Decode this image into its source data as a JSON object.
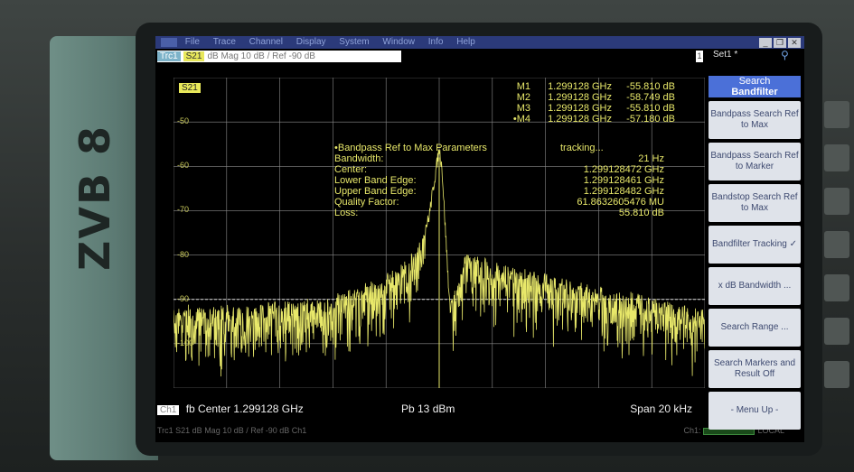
{
  "device": {
    "brand": "ZVB 8"
  },
  "menubar": {
    "items": [
      "File",
      "Trace",
      "Channel",
      "Display",
      "System",
      "Window",
      "Info",
      "Help"
    ]
  },
  "set_label": "Set1 *",
  "trace_header": {
    "trc": "Trc1",
    "param": "S21",
    "rest": "dB Mag  10 dB /  Ref -90 dB"
  },
  "page_num": "1",
  "trace_chip": "S21",
  "y_tick_labels": [
    "-50",
    "-60",
    "-70",
    "-80",
    "-90",
    "-100"
  ],
  "markers": [
    {
      "id": "M1",
      "freq": "1.299128 GHz",
      "value": "-55.810 dB"
    },
    {
      "id": "M2",
      "freq": "1.299128 GHz",
      "value": "-58.749 dB"
    },
    {
      "id": "M3",
      "freq": "1.299128 GHz",
      "value": "-55.810 dB"
    },
    {
      "id": "•M4",
      "freq": "1.299128 GHz",
      "value": "-57.180 dB"
    }
  ],
  "params": {
    "title": "•Bandpass Ref to Max Parameters",
    "status": "tracking...",
    "rows": [
      {
        "label": "Bandwidth:",
        "value": "21 Hz"
      },
      {
        "label": "Center:",
        "value": "1.299128472 GHz"
      },
      {
        "label": "Lower Band Edge:",
        "value": "1.299128461 GHz"
      },
      {
        "label": "Upper Band Edge:",
        "value": "1.299128482 GHz"
      },
      {
        "label": "Quality Factor:",
        "value": "61.8632605476 MU"
      },
      {
        "label": "Loss:",
        "value": "55.810 dB"
      }
    ]
  },
  "status_bar": {
    "ch": "Ch1",
    "center": "fb  Center  1.299128 GHz",
    "power": "Pb  13 dBm",
    "span": "Span  20 kHz"
  },
  "footer": {
    "left": "Trc1   S21   dB Mag   10 dB / Ref -90 dB   Ch1",
    "ch_label": "Ch1:",
    "local": "LOCAL"
  },
  "softkeys": {
    "title_top": "Search",
    "title_main": "Bandfilter",
    "items": [
      "Bandpass Search Ref to Max",
      "Bandpass Search Ref to Marker",
      "Bandstop Search Ref to Max",
      "Bandfilter Tracking ✓",
      "x dB Bandwidth ...",
      "Search Range ...",
      "Search Markers and Result Off",
      "- Menu Up -"
    ]
  },
  "colors": {
    "trace": "#e8e86a",
    "grid": "#8a8a8a",
    "softkey_title": "#4b70d8"
  },
  "chart_data": {
    "type": "line",
    "ylim": [
      -110,
      -40
    ],
    "reference_level": -90,
    "grid": true,
    "series": [
      {
        "x": [
          0,
          1,
          2,
          3,
          4,
          4.5,
          4.8,
          4.95,
          5,
          5.05,
          5.2,
          5.5,
          6,
          7,
          8,
          9,
          10
        ],
        "values": [
          -92,
          -92,
          -91,
          -90,
          -85,
          -80,
          -72,
          -60,
          -56,
          -60,
          -92,
          -80,
          -82,
          -85,
          -88,
          -90,
          -93
        ]
      }
    ]
  }
}
